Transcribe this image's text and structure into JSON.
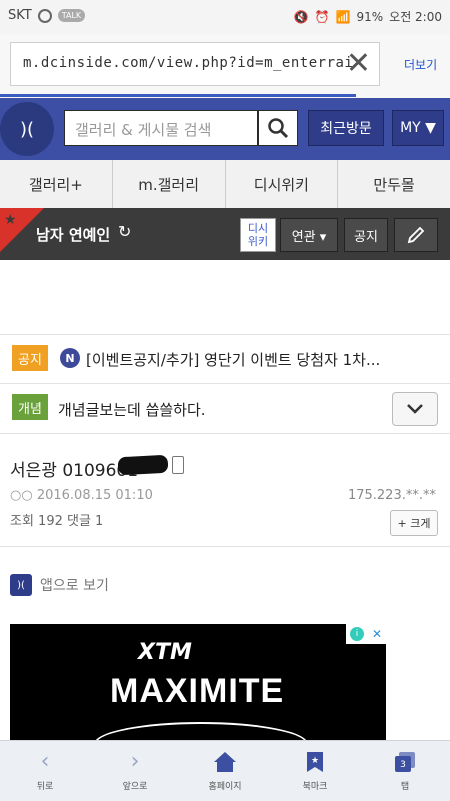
{
  "status_bar": {
    "carrier": "SKT",
    "talk": "TALK",
    "battery": "91%",
    "time": "오전 2:00"
  },
  "browser": {
    "url": "m.dcinside.com/view.php?id=m_enterrai",
    "more_label": "더보기"
  },
  "header": {
    "logo": ")(",
    "search_placeholder": "갤러리 & 게시물 검색",
    "recent_label": "최근방문",
    "my_label": "MY ▼"
  },
  "nav": {
    "items": [
      "갤러리+",
      "m.갤러리",
      "디시위키",
      "만두몰"
    ]
  },
  "gallery": {
    "name": "남자 연예인",
    "dsi_line1": "디시",
    "dsi_line2": "위키",
    "related_label": "연관 ▾",
    "notice_label": "공지"
  },
  "notice1": {
    "tag": "공지",
    "badge": "N",
    "text": "[이벤트공지/추가] 영단기 이벤트 당첨자 1차..."
  },
  "notice2": {
    "tag": "개념",
    "text": "개념글보는데 씁쓸하다."
  },
  "post": {
    "title": "서은광 0109601",
    "author": "○○",
    "date": "2016.08.15 01:10",
    "ip": "175.223.**.**",
    "stats": "조회 192 댓글 1",
    "bigger_label": "+ 크게"
  },
  "app_view": {
    "icon": ")(",
    "label": "앱으로 보기"
  },
  "ad": {
    "brand": "XTM",
    "title": "MAXIMITE"
  },
  "toolbar": {
    "items": [
      {
        "label": "뒤로",
        "icon": "back-chevron"
      },
      {
        "label": "앞으로",
        "icon": "forward-chevron"
      },
      {
        "label": "홈페이지",
        "icon": "home"
      },
      {
        "label": "북마크",
        "icon": "bookmark-star"
      },
      {
        "label": "탭",
        "icon": "tabs",
        "count": "3"
      }
    ]
  }
}
